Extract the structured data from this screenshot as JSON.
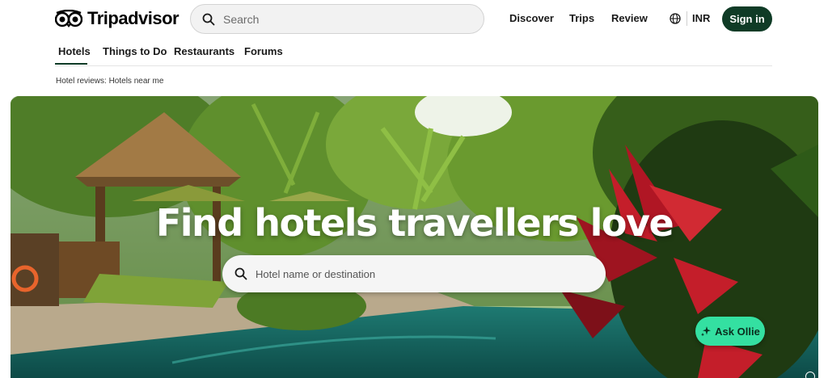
{
  "brand": {
    "name": "Tripadvisor"
  },
  "header": {
    "search_placeholder": "Search",
    "nav": [
      "Discover",
      "Trips",
      "Review"
    ],
    "currency": "INR",
    "signin_label": "Sign in"
  },
  "tabs": [
    {
      "label": "Hotels",
      "active": true
    },
    {
      "label": "Things to Do"
    },
    {
      "label": "Restaurants"
    },
    {
      "label": "Forums"
    }
  ],
  "breadcrumb": "Hotel reviews: Hotels near me",
  "hero": {
    "title": "Find hotels travellers love",
    "search_placeholder": "Hotel name or destination",
    "ask_button": "Ask Ollie"
  },
  "colors": {
    "brand_dark": "#0f3b26",
    "accent": "#34e0a1"
  },
  "icons": [
    "tripadvisor-owl-logo-icon",
    "search-icon",
    "globe-icon",
    "sparkle-icon"
  ]
}
